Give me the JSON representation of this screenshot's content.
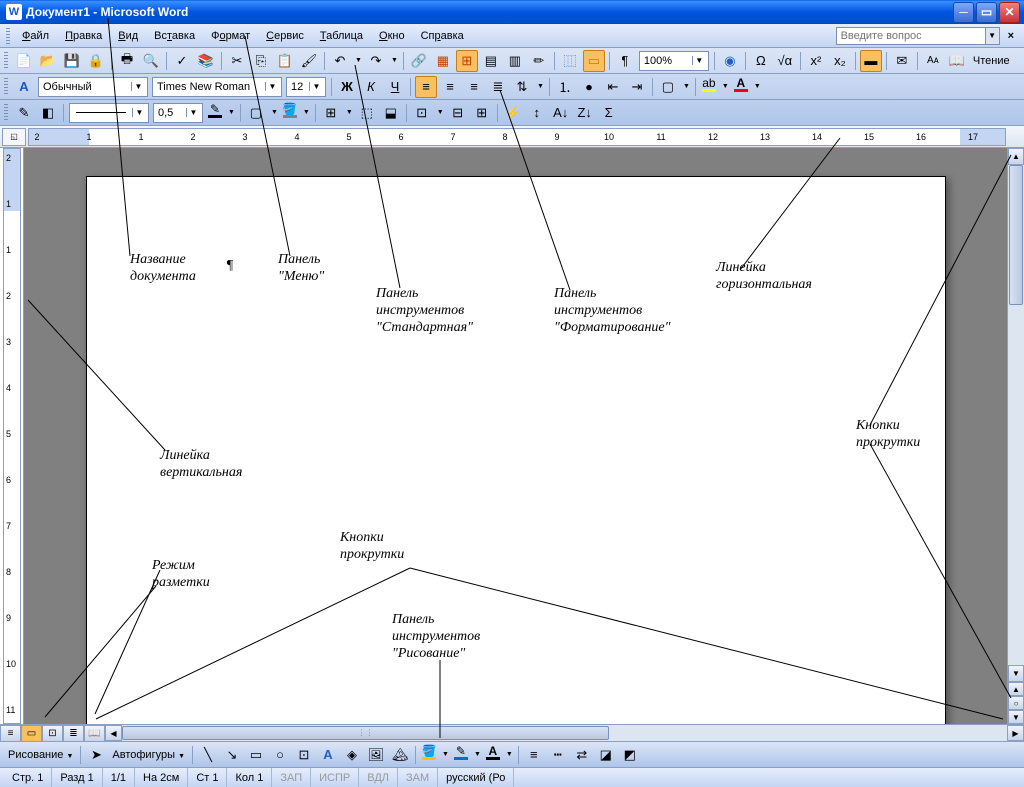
{
  "title": "Документ1 - Microsoft Word",
  "menu": [
    "Файл",
    "Правка",
    "Вид",
    "Вставка",
    "Формат",
    "Сервис",
    "Таблица",
    "Окно",
    "Справка"
  ],
  "menu_underline_idx": [
    0,
    0,
    0,
    2,
    1,
    0,
    0,
    0,
    2
  ],
  "help_placeholder": "Введите вопрос",
  "toolbars": {
    "tb1": {
      "zoom": "100%",
      "reading": "Чтение"
    },
    "tb2": {
      "style_label": "",
      "style": "Обычный",
      "font": "Times New Roman",
      "size": "12"
    },
    "tb3": {
      "lineheight": "0,5"
    },
    "drawing": {
      "label": "Рисование",
      "autoshapes": "Автофигуры"
    }
  },
  "ruler_ticks": [
    2,
    1,
    1,
    2,
    3,
    4,
    5,
    6,
    7,
    8,
    9,
    10,
    11,
    12,
    13,
    14,
    15,
    16,
    17
  ],
  "v_ruler_ticks": [
    2,
    1,
    1,
    2,
    3,
    4,
    5,
    6,
    7,
    8,
    9,
    10,
    11
  ],
  "status": {
    "page": "Стр. 1",
    "section": "Разд 1",
    "pages": "1/1",
    "at": "На 2см",
    "line": "Ст 1",
    "col": "Кол 1",
    "rec": "ЗАП",
    "fix": "ИСПР",
    "ext": "ВДЛ",
    "ovr": "ЗАМ",
    "lang": "русский (Ро"
  },
  "annotations": {
    "doc_name": "Название\nдокумента",
    "menu_panel": "Панель\n\"Меню\"",
    "std_toolbar": "Панель\nинструментов\n\"Стандартная\"",
    "fmt_toolbar": "Панель\nинструментов\n\"Форматирование\"",
    "h_ruler": "Линейка\nгоризонтальная",
    "v_ruler": "Линейка\nвертикальная",
    "scroll_btns": "Кнопки\nпрокрутки",
    "scroll_btns2": "Кнопки\nпрокрутки",
    "layout_mode": "Режим\nразметки",
    "draw_toolbar": "Панель\nинструментов\n\"Рисование\""
  },
  "pilcrow": "¶"
}
